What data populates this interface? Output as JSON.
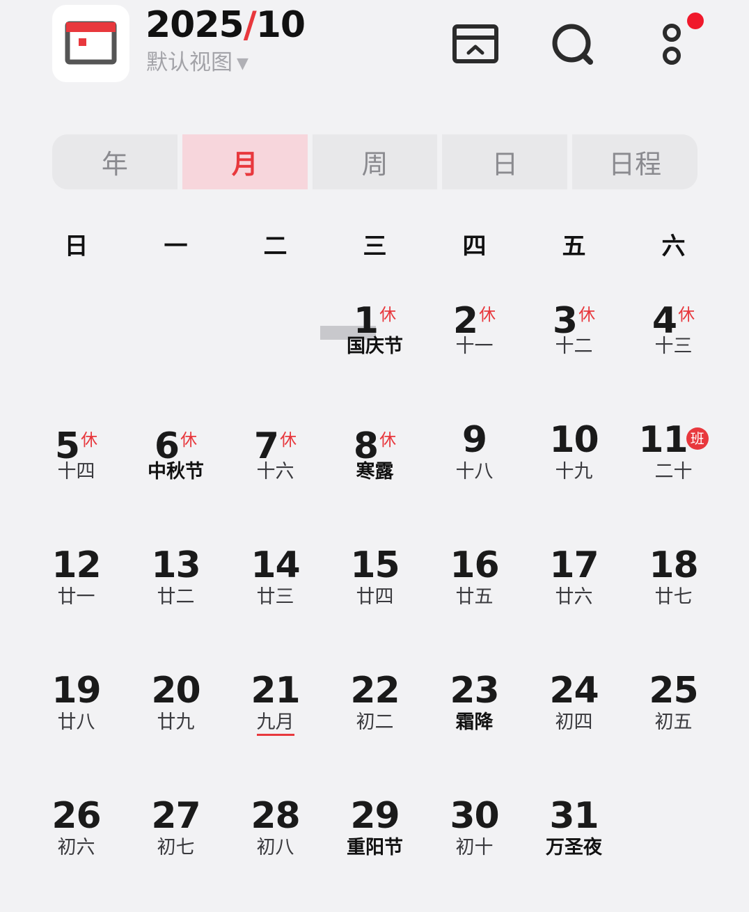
{
  "header": {
    "year": "2025",
    "slash": "/",
    "month": "10",
    "view_label": "默认视图",
    "caret": "▼"
  },
  "tabs": [
    "年",
    "月",
    "周",
    "日",
    "日程"
  ],
  "active_tab": "月",
  "weekdays": [
    "日",
    "一",
    "二",
    "三",
    "四",
    "五",
    "六"
  ],
  "days": [
    {
      "n": "1",
      "tag": "休",
      "lunar": "国庆节",
      "bold": true
    },
    {
      "n": "2",
      "tag": "休",
      "lunar": "十一"
    },
    {
      "n": "3",
      "tag": "休",
      "lunar": "十二"
    },
    {
      "n": "4",
      "tag": "休",
      "lunar": "十三"
    },
    {
      "n": "5",
      "tag": "休",
      "lunar": "十四"
    },
    {
      "n": "6",
      "tag": "休",
      "lunar": "中秋节",
      "bold": true
    },
    {
      "n": "7",
      "tag": "休",
      "lunar": "十六"
    },
    {
      "n": "8",
      "tag": "休",
      "lunar": "寒露",
      "bold": true
    },
    {
      "n": "9",
      "lunar": "十八"
    },
    {
      "n": "10",
      "lunar": "十九"
    },
    {
      "n": "11",
      "ban": "班",
      "lunar": "二十"
    },
    {
      "n": "12",
      "lunar": "廿一"
    },
    {
      "n": "13",
      "lunar": "廿二"
    },
    {
      "n": "14",
      "lunar": "廿三"
    },
    {
      "n": "15",
      "lunar": "廿四"
    },
    {
      "n": "16",
      "lunar": "廿五"
    },
    {
      "n": "17",
      "lunar": "廿六"
    },
    {
      "n": "18",
      "lunar": "廿七"
    },
    {
      "n": "19",
      "lunar": "廿八"
    },
    {
      "n": "20",
      "lunar": "廿九"
    },
    {
      "n": "21",
      "lunar": "九月",
      "underline": true
    },
    {
      "n": "22",
      "lunar": "初二"
    },
    {
      "n": "23",
      "lunar": "霜降",
      "bold": true
    },
    {
      "n": "24",
      "lunar": "初四"
    },
    {
      "n": "25",
      "lunar": "初五"
    },
    {
      "n": "26",
      "lunar": "初六"
    },
    {
      "n": "27",
      "lunar": "初七"
    },
    {
      "n": "28",
      "lunar": "初八"
    },
    {
      "n": "29",
      "lunar": "重阳节",
      "bold": true
    },
    {
      "n": "30",
      "lunar": "初十"
    },
    {
      "n": "31",
      "lunar": "万圣夜",
      "bold": true
    }
  ],
  "first_weekday_index": 3,
  "colors": {
    "accent": "#e8383d",
    "tab_active_bg": "#f7d6dc",
    "notification": "#f0192b"
  },
  "icons": [
    "calendar-app-icon",
    "today-icon",
    "search-icon",
    "more-icon"
  ]
}
